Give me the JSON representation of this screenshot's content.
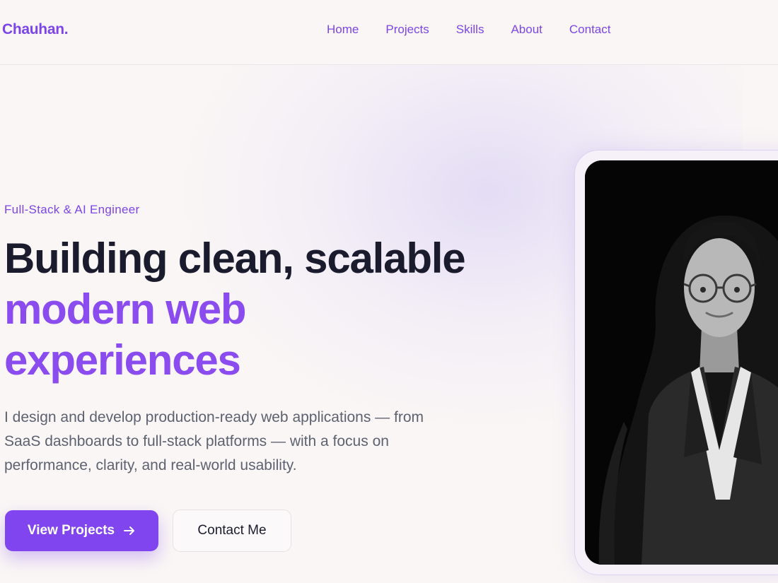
{
  "nav": {
    "logo": "Chauhan.",
    "links": [
      "Home",
      "Projects",
      "Skills",
      "About",
      "Contact"
    ]
  },
  "hero": {
    "eyebrow": "Full-Stack & AI Engineer",
    "headline_line1": "Building clean, scalable",
    "headline_line2": "modern web",
    "headline_line3": "experiences",
    "description": "I design and develop production-ready web applications — from SaaS dashboards to full-stack platforms — with a focus on performance, clarity, and real-world usability.",
    "primary_button": "View Projects",
    "primary_button_icon": "arrow-right-icon",
    "secondary_button": "Contact Me",
    "portrait_style": "black-and-white"
  },
  "colors": {
    "accent": "#8045ee",
    "heading": "#1a1c2e",
    "body_text": "#5d6270",
    "background": "#faf6f5"
  }
}
